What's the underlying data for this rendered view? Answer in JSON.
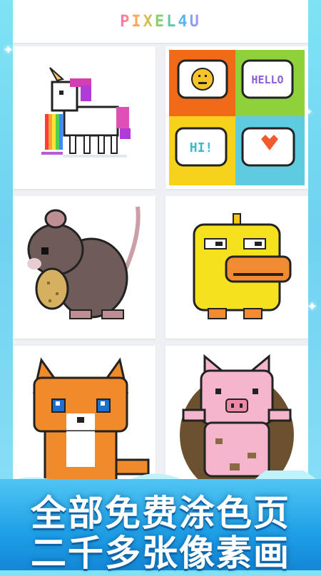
{
  "app": {
    "title": "PIXEL4U"
  },
  "gallery": {
    "items": [
      {
        "name": "Unicorn"
      },
      {
        "name": "Speech bubbles"
      },
      {
        "name": "Hamster"
      },
      {
        "name": "Duck"
      },
      {
        "name": "Fox"
      },
      {
        "name": "Pig"
      }
    ]
  },
  "bubbles_art": {
    "hello": "HELLO",
    "hi": "HI!"
  },
  "promo": {
    "line1": "全部免费涂色页",
    "line2": "二千多张像素画"
  },
  "colors": {
    "banner": "#1e9fe6",
    "background": "#7fe3f5",
    "card": "#ffffff"
  }
}
